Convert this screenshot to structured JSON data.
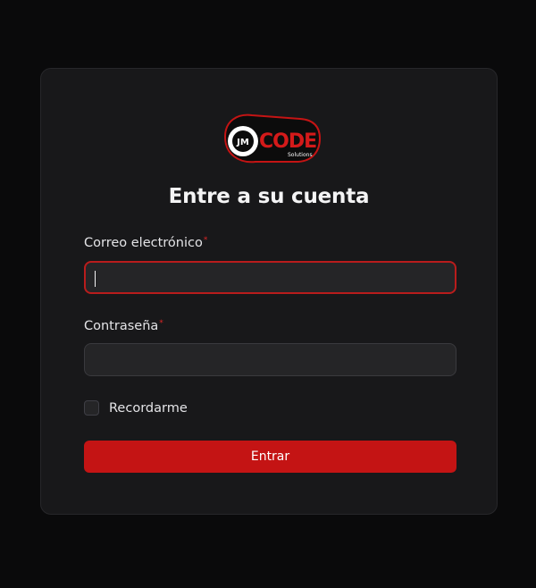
{
  "brand": {
    "logo_text": "CODE",
    "logo_subtext": "Solutions",
    "logo_mark": "JM",
    "accent_color": "#c41414"
  },
  "login": {
    "title": "Entre a su cuenta",
    "email_label": "Correo electrónico",
    "email_value": "",
    "password_label": "Contraseña",
    "password_value": "",
    "required_mark": "*",
    "remember_label": "Recordarme",
    "remember_checked": false,
    "submit_label": "Entrar"
  }
}
